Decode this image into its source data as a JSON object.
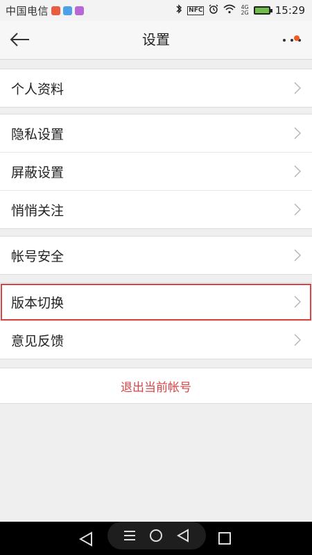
{
  "status_bar": {
    "carrier": "中国电信",
    "mini_apps": [
      "#e85c3f",
      "#4ea1e8",
      "#b768d5"
    ],
    "nfc_label": "NFC",
    "network_top": "4G",
    "network_bottom": "2G",
    "time": "15:29"
  },
  "header": {
    "title": "设置"
  },
  "groups": [
    {
      "items": [
        {
          "label": "个人资料"
        }
      ]
    },
    {
      "items": [
        {
          "label": "隐私设置"
        },
        {
          "label": "屏蔽设置"
        },
        {
          "label": "悄悄关注"
        }
      ]
    },
    {
      "items": [
        {
          "label": "帐号安全"
        }
      ]
    },
    {
      "items": [
        {
          "label": "版本切换",
          "highlighted": true
        },
        {
          "label": "意见反馈"
        }
      ]
    }
  ],
  "logout": {
    "label": "退出当前帐号"
  },
  "colors": {
    "accent": "#d64545",
    "badge": "#f15a24"
  }
}
